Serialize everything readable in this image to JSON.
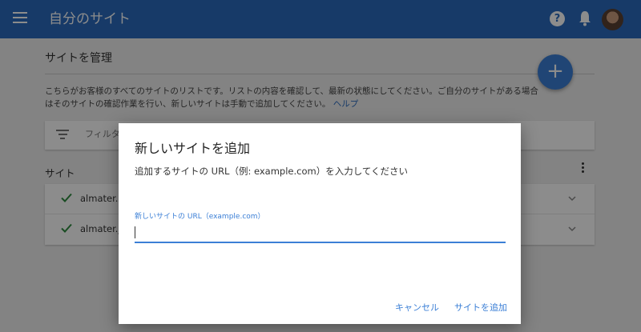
{
  "header": {
    "title": "自分のサイト",
    "menu_icon": "menu-icon",
    "help_icon": "help-icon",
    "notifications_icon": "bell-icon",
    "avatar_icon": "user-avatar"
  },
  "manage": {
    "title": "サイトを管理",
    "description_line1": "こちらがお客様のすべてのサイトのリストです。リストの内容を確認して、最新の状態にしてください。ご自分のサイトがある場合",
    "description_line2": "はそのサイトの確認作業を行い、新しいサイトは手動で追加してください。",
    "help_link": "ヘルプ",
    "add_button": "+"
  },
  "filter": {
    "placeholder": "フィルタ"
  },
  "sites": {
    "heading": "サイト",
    "items": [
      {
        "name": "almater.c"
      },
      {
        "name": "almater.jp"
      }
    ]
  },
  "dialog": {
    "title": "新しいサイトを追加",
    "instruction": "追加するサイトの URL（例: example.com）を入力してください",
    "field_label": "新しいサイトの URL（example.com）",
    "field_value": "",
    "cancel_label": "キャンセル",
    "confirm_label": "サイトを追加"
  },
  "colors": {
    "brand": "#2a6bbd",
    "accent": "#3b7fd6",
    "check": "#2e8b3e"
  }
}
